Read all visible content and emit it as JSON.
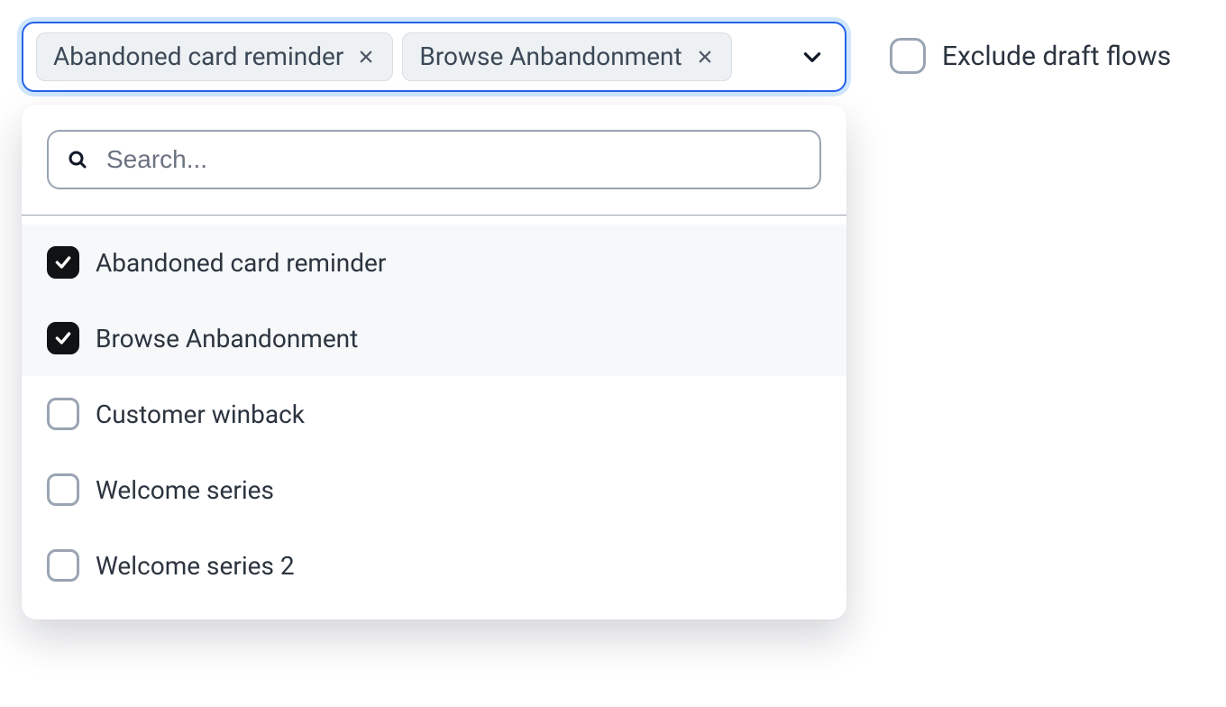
{
  "multiselect": {
    "chips": [
      {
        "label": "Abandoned card reminder"
      },
      {
        "label": "Browse Anbandonment"
      }
    ],
    "search_placeholder": "Search...",
    "options": [
      {
        "label": "Abandoned card reminder",
        "checked": true
      },
      {
        "label": "Browse Anbandonment",
        "checked": true
      },
      {
        "label": "Customer winback",
        "checked": false
      },
      {
        "label": "Welcome series",
        "checked": false
      },
      {
        "label": "Welcome series 2",
        "checked": false
      }
    ]
  },
  "exclude_drafts": {
    "label": "Exclude draft flows",
    "checked": false
  }
}
